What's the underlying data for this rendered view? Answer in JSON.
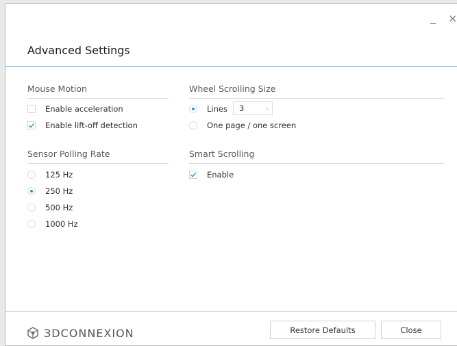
{
  "window": {
    "title": "Advanced Settings",
    "minimize_glyph": "_",
    "close_glyph": "✕"
  },
  "mouse_motion": {
    "title": "Mouse Motion",
    "options": [
      {
        "label": "Enable acceleration",
        "checked": false
      },
      {
        "label": "Enable lift-off detection",
        "checked": true
      }
    ]
  },
  "sensor_polling_rate": {
    "title": "Sensor Polling Rate",
    "options": [
      {
        "label": "125 Hz",
        "selected": false
      },
      {
        "label": "250 Hz",
        "selected": true
      },
      {
        "label": "500 Hz",
        "selected": false
      },
      {
        "label": "1000 Hz",
        "selected": false
      }
    ]
  },
  "wheel_scrolling_size": {
    "title": "Wheel Scrolling Size",
    "lines_label": "Lines",
    "lines_value": "3",
    "page_label": "One page / one screen",
    "selected": "lines",
    "spinner_arrow": "›"
  },
  "smart_scrolling": {
    "title": "Smart Scrolling",
    "enable_label": "Enable",
    "enabled": true
  },
  "footer": {
    "logo_text": "ЗDCONNEXION",
    "restore_label": "Restore Defaults",
    "close_label": "Close"
  },
  "colors": {
    "accent": "#2b9bd3",
    "header_rule": "#47a7d6"
  }
}
